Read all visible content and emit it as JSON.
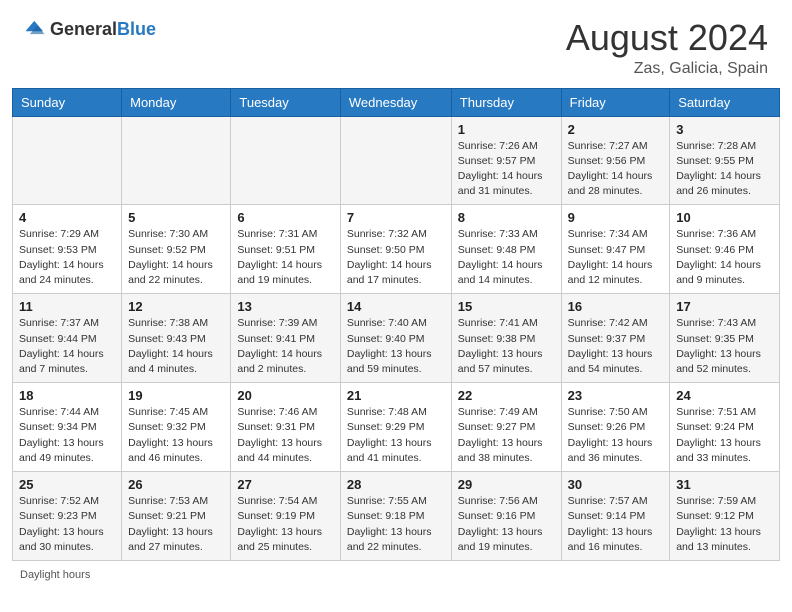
{
  "header": {
    "logo_general": "General",
    "logo_blue": "Blue",
    "month_year": "August 2024",
    "location": "Zas, Galicia, Spain"
  },
  "weekdays": [
    "Sunday",
    "Monday",
    "Tuesday",
    "Wednesday",
    "Thursday",
    "Friday",
    "Saturday"
  ],
  "weeks": [
    [
      {
        "day": "",
        "info": ""
      },
      {
        "day": "",
        "info": ""
      },
      {
        "day": "",
        "info": ""
      },
      {
        "day": "",
        "info": ""
      },
      {
        "day": "1",
        "info": "Sunrise: 7:26 AM\nSunset: 9:57 PM\nDaylight: 14 hours\nand 31 minutes."
      },
      {
        "day": "2",
        "info": "Sunrise: 7:27 AM\nSunset: 9:56 PM\nDaylight: 14 hours\nand 28 minutes."
      },
      {
        "day": "3",
        "info": "Sunrise: 7:28 AM\nSunset: 9:55 PM\nDaylight: 14 hours\nand 26 minutes."
      }
    ],
    [
      {
        "day": "4",
        "info": "Sunrise: 7:29 AM\nSunset: 9:53 PM\nDaylight: 14 hours\nand 24 minutes."
      },
      {
        "day": "5",
        "info": "Sunrise: 7:30 AM\nSunset: 9:52 PM\nDaylight: 14 hours\nand 22 minutes."
      },
      {
        "day": "6",
        "info": "Sunrise: 7:31 AM\nSunset: 9:51 PM\nDaylight: 14 hours\nand 19 minutes."
      },
      {
        "day": "7",
        "info": "Sunrise: 7:32 AM\nSunset: 9:50 PM\nDaylight: 14 hours\nand 17 minutes."
      },
      {
        "day": "8",
        "info": "Sunrise: 7:33 AM\nSunset: 9:48 PM\nDaylight: 14 hours\nand 14 minutes."
      },
      {
        "day": "9",
        "info": "Sunrise: 7:34 AM\nSunset: 9:47 PM\nDaylight: 14 hours\nand 12 minutes."
      },
      {
        "day": "10",
        "info": "Sunrise: 7:36 AM\nSunset: 9:46 PM\nDaylight: 14 hours\nand 9 minutes."
      }
    ],
    [
      {
        "day": "11",
        "info": "Sunrise: 7:37 AM\nSunset: 9:44 PM\nDaylight: 14 hours\nand 7 minutes."
      },
      {
        "day": "12",
        "info": "Sunrise: 7:38 AM\nSunset: 9:43 PM\nDaylight: 14 hours\nand 4 minutes."
      },
      {
        "day": "13",
        "info": "Sunrise: 7:39 AM\nSunset: 9:41 PM\nDaylight: 14 hours\nand 2 minutes."
      },
      {
        "day": "14",
        "info": "Sunrise: 7:40 AM\nSunset: 9:40 PM\nDaylight: 13 hours\nand 59 minutes."
      },
      {
        "day": "15",
        "info": "Sunrise: 7:41 AM\nSunset: 9:38 PM\nDaylight: 13 hours\nand 57 minutes."
      },
      {
        "day": "16",
        "info": "Sunrise: 7:42 AM\nSunset: 9:37 PM\nDaylight: 13 hours\nand 54 minutes."
      },
      {
        "day": "17",
        "info": "Sunrise: 7:43 AM\nSunset: 9:35 PM\nDaylight: 13 hours\nand 52 minutes."
      }
    ],
    [
      {
        "day": "18",
        "info": "Sunrise: 7:44 AM\nSunset: 9:34 PM\nDaylight: 13 hours\nand 49 minutes."
      },
      {
        "day": "19",
        "info": "Sunrise: 7:45 AM\nSunset: 9:32 PM\nDaylight: 13 hours\nand 46 minutes."
      },
      {
        "day": "20",
        "info": "Sunrise: 7:46 AM\nSunset: 9:31 PM\nDaylight: 13 hours\nand 44 minutes."
      },
      {
        "day": "21",
        "info": "Sunrise: 7:48 AM\nSunset: 9:29 PM\nDaylight: 13 hours\nand 41 minutes."
      },
      {
        "day": "22",
        "info": "Sunrise: 7:49 AM\nSunset: 9:27 PM\nDaylight: 13 hours\nand 38 minutes."
      },
      {
        "day": "23",
        "info": "Sunrise: 7:50 AM\nSunset: 9:26 PM\nDaylight: 13 hours\nand 36 minutes."
      },
      {
        "day": "24",
        "info": "Sunrise: 7:51 AM\nSunset: 9:24 PM\nDaylight: 13 hours\nand 33 minutes."
      }
    ],
    [
      {
        "day": "25",
        "info": "Sunrise: 7:52 AM\nSunset: 9:23 PM\nDaylight: 13 hours\nand 30 minutes."
      },
      {
        "day": "26",
        "info": "Sunrise: 7:53 AM\nSunset: 9:21 PM\nDaylight: 13 hours\nand 27 minutes."
      },
      {
        "day": "27",
        "info": "Sunrise: 7:54 AM\nSunset: 9:19 PM\nDaylight: 13 hours\nand 25 minutes."
      },
      {
        "day": "28",
        "info": "Sunrise: 7:55 AM\nSunset: 9:18 PM\nDaylight: 13 hours\nand 22 minutes."
      },
      {
        "day": "29",
        "info": "Sunrise: 7:56 AM\nSunset: 9:16 PM\nDaylight: 13 hours\nand 19 minutes."
      },
      {
        "day": "30",
        "info": "Sunrise: 7:57 AM\nSunset: 9:14 PM\nDaylight: 13 hours\nand 16 minutes."
      },
      {
        "day": "31",
        "info": "Sunrise: 7:59 AM\nSunset: 9:12 PM\nDaylight: 13 hours\nand 13 minutes."
      }
    ]
  ],
  "footer": {
    "daylight_label": "Daylight hours"
  }
}
